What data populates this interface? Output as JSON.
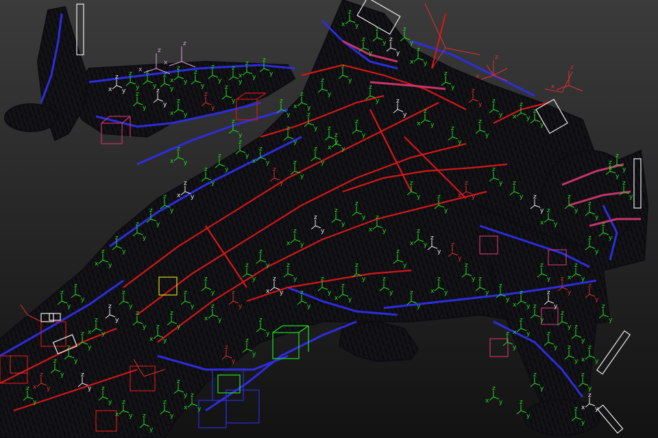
{
  "viewport": {
    "background_top": "#3b3b3b",
    "background_bottom": "#121212"
  },
  "wire_colors": {
    "mesh": "#0c0c12",
    "red": "#d41818",
    "blue": "#2d2de0",
    "magenta": "#c8346a",
    "green": "#22e022",
    "white": "#f0f0f0"
  },
  "icons": {
    "pivot_gizmo": "axis-tripod-icon",
    "helper_box": "dummy-box-icon"
  },
  "gizmo_axes": {
    "x": "x",
    "y": "y",
    "z": "z"
  }
}
